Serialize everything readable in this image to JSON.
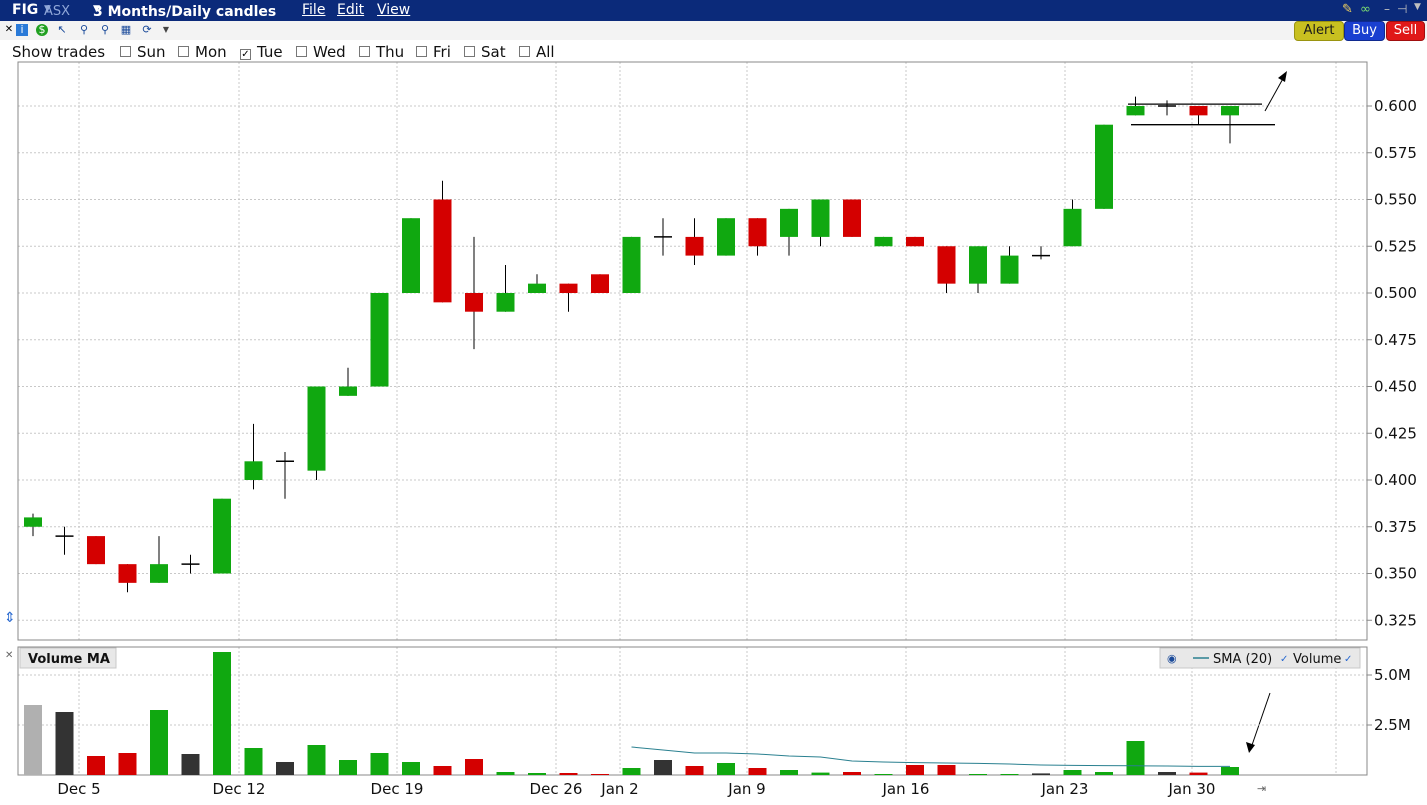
{
  "titlebar": {
    "symbol": "FIG",
    "exchange": "ASX",
    "period": "3 Months/Daily candles",
    "menu": [
      "File",
      "Edit",
      "View"
    ]
  },
  "buttons": {
    "alert": "Alert",
    "buy": "Buy",
    "sell": "Sell"
  },
  "show_trades": {
    "label": "Show trades",
    "days": [
      {
        "label": "Sun",
        "checked": false
      },
      {
        "label": "Mon",
        "checked": false
      },
      {
        "label": "Tue",
        "checked": true
      },
      {
        "label": "Wed",
        "checked": false
      },
      {
        "label": "Thu",
        "checked": false
      },
      {
        "label": "Fri",
        "checked": false
      },
      {
        "label": "Sat",
        "checked": false
      },
      {
        "label": "All",
        "checked": false
      }
    ]
  },
  "colors": {
    "up": "#10a810",
    "down": "#d40000",
    "flat": "#333333",
    "vol_old": "#b0b0b0",
    "sma": "#2a8090",
    "titlebar": "#0b2a7a"
  },
  "chart_data": [
    {
      "type": "candlestick",
      "ylim": [
        0.31,
        0.62
      ],
      "yticks": [
        "0.600",
        "0.575",
        "0.550",
        "0.525",
        "0.500",
        "0.475",
        "0.450",
        "0.425",
        "0.400",
        "0.375",
        "0.350",
        "0.325"
      ],
      "xtick_labels": [
        "Dec 5",
        "Dec 12",
        "Dec 19",
        "Dec 26",
        "Jan 2",
        "Jan 9",
        "Jan 16",
        "Jan 23",
        "Jan 30"
      ],
      "candles": [
        {
          "o": 0.375,
          "h": 0.382,
          "l": 0.37,
          "c": 0.38
        },
        {
          "o": 0.37,
          "h": 0.375,
          "l": 0.36,
          "c": 0.37
        },
        {
          "o": 0.37,
          "h": 0.37,
          "l": 0.355,
          "c": 0.355
        },
        {
          "o": 0.355,
          "h": 0.355,
          "l": 0.34,
          "c": 0.345
        },
        {
          "o": 0.345,
          "h": 0.37,
          "l": 0.345,
          "c": 0.355
        },
        {
          "o": 0.355,
          "h": 0.36,
          "l": 0.35,
          "c": 0.355
        },
        {
          "o": 0.35,
          "h": 0.39,
          "l": 0.35,
          "c": 0.39
        },
        {
          "o": 0.4,
          "h": 0.43,
          "l": 0.395,
          "c": 0.41
        },
        {
          "o": 0.41,
          "h": 0.415,
          "l": 0.39,
          "c": 0.41
        },
        {
          "o": 0.405,
          "h": 0.45,
          "l": 0.4,
          "c": 0.45
        },
        {
          "o": 0.445,
          "h": 0.46,
          "l": 0.445,
          "c": 0.45
        },
        {
          "o": 0.45,
          "h": 0.5,
          "l": 0.45,
          "c": 0.5
        },
        {
          "o": 0.5,
          "h": 0.54,
          "l": 0.5,
          "c": 0.54
        },
        {
          "o": 0.55,
          "h": 0.56,
          "l": 0.495,
          "c": 0.495
        },
        {
          "o": 0.5,
          "h": 0.53,
          "l": 0.47,
          "c": 0.49
        },
        {
          "o": 0.49,
          "h": 0.515,
          "l": 0.49,
          "c": 0.5
        },
        {
          "o": 0.5,
          "h": 0.51,
          "l": 0.5,
          "c": 0.505
        },
        {
          "o": 0.505,
          "h": 0.505,
          "l": 0.49,
          "c": 0.5
        },
        {
          "o": 0.51,
          "h": 0.51,
          "l": 0.5,
          "c": 0.5
        },
        {
          "o": 0.5,
          "h": 0.53,
          "l": 0.5,
          "c": 0.53
        },
        {
          "o": 0.53,
          "h": 0.54,
          "l": 0.52,
          "c": 0.53
        },
        {
          "o": 0.53,
          "h": 0.54,
          "l": 0.515,
          "c": 0.52
        },
        {
          "o": 0.52,
          "h": 0.54,
          "l": 0.52,
          "c": 0.54
        },
        {
          "o": 0.54,
          "h": 0.54,
          "l": 0.52,
          "c": 0.525
        },
        {
          "o": 0.53,
          "h": 0.545,
          "l": 0.52,
          "c": 0.545
        },
        {
          "o": 0.53,
          "h": 0.55,
          "l": 0.525,
          "c": 0.55
        },
        {
          "o": 0.55,
          "h": 0.55,
          "l": 0.53,
          "c": 0.53
        },
        {
          "o": 0.525,
          "h": 0.53,
          "l": 0.525,
          "c": 0.53
        },
        {
          "o": 0.53,
          "h": 0.53,
          "l": 0.525,
          "c": 0.525
        },
        {
          "o": 0.525,
          "h": 0.525,
          "l": 0.5,
          "c": 0.505
        },
        {
          "o": 0.505,
          "h": 0.525,
          "l": 0.5,
          "c": 0.525
        },
        {
          "o": 0.505,
          "h": 0.525,
          "l": 0.505,
          "c": 0.52
        },
        {
          "o": 0.52,
          "h": 0.525,
          "l": 0.518,
          "c": 0.52
        },
        {
          "o": 0.525,
          "h": 0.55,
          "l": 0.525,
          "c": 0.545
        },
        {
          "o": 0.545,
          "h": 0.59,
          "l": 0.545,
          "c": 0.59
        },
        {
          "o": 0.595,
          "h": 0.605,
          "l": 0.595,
          "c": 0.6
        },
        {
          "o": 0.6,
          "h": 0.603,
          "l": 0.595,
          "c": 0.6
        },
        {
          "o": 0.6,
          "h": 0.6,
          "l": 0.59,
          "c": 0.595
        },
        {
          "o": 0.595,
          "h": 0.6,
          "l": 0.58,
          "c": 0.6
        }
      ]
    },
    {
      "type": "bar",
      "title": "Volume MA",
      "legend": [
        "SMA (20)",
        "Volume"
      ],
      "ylim": [
        0,
        6000000
      ],
      "yticks": [
        "5.0M",
        "2.5M"
      ],
      "values": [
        3500000,
        3150000,
        950000,
        1100000,
        3250000,
        1050000,
        6150000,
        1350000,
        650000,
        1500000,
        750000,
        1100000,
        650000,
        450000,
        800000,
        150000,
        100000,
        100000,
        50000,
        350000,
        750000,
        450000,
        600000,
        350000,
        250000,
        120000,
        150000,
        50000,
        500000,
        500000,
        50000,
        50000,
        80000,
        250000,
        150000,
        1700000,
        150000,
        120000,
        400000
      ],
      "colors": [
        "old",
        "flat",
        "down",
        "down",
        "up",
        "flat",
        "up",
        "up",
        "flat",
        "up",
        "up",
        "up",
        "up",
        "down",
        "down",
        "up",
        "up",
        "down",
        "down",
        "up",
        "flat",
        "down",
        "up",
        "down",
        "up",
        "up",
        "down",
        "up",
        "down",
        "down",
        "up",
        "up",
        "flat",
        "up",
        "up",
        "up",
        "flat",
        "down",
        "up"
      ],
      "sma_values": [
        null,
        null,
        null,
        null,
        null,
        null,
        null,
        null,
        null,
        null,
        null,
        null,
        null,
        null,
        null,
        null,
        null,
        null,
        null,
        1400000,
        1250000,
        1100000,
        1100000,
        1050000,
        950000,
        900000,
        700000,
        650000,
        620000,
        600000,
        580000,
        550000,
        500000,
        480000,
        470000,
        460000,
        450000,
        430000,
        430000
      ]
    }
  ]
}
